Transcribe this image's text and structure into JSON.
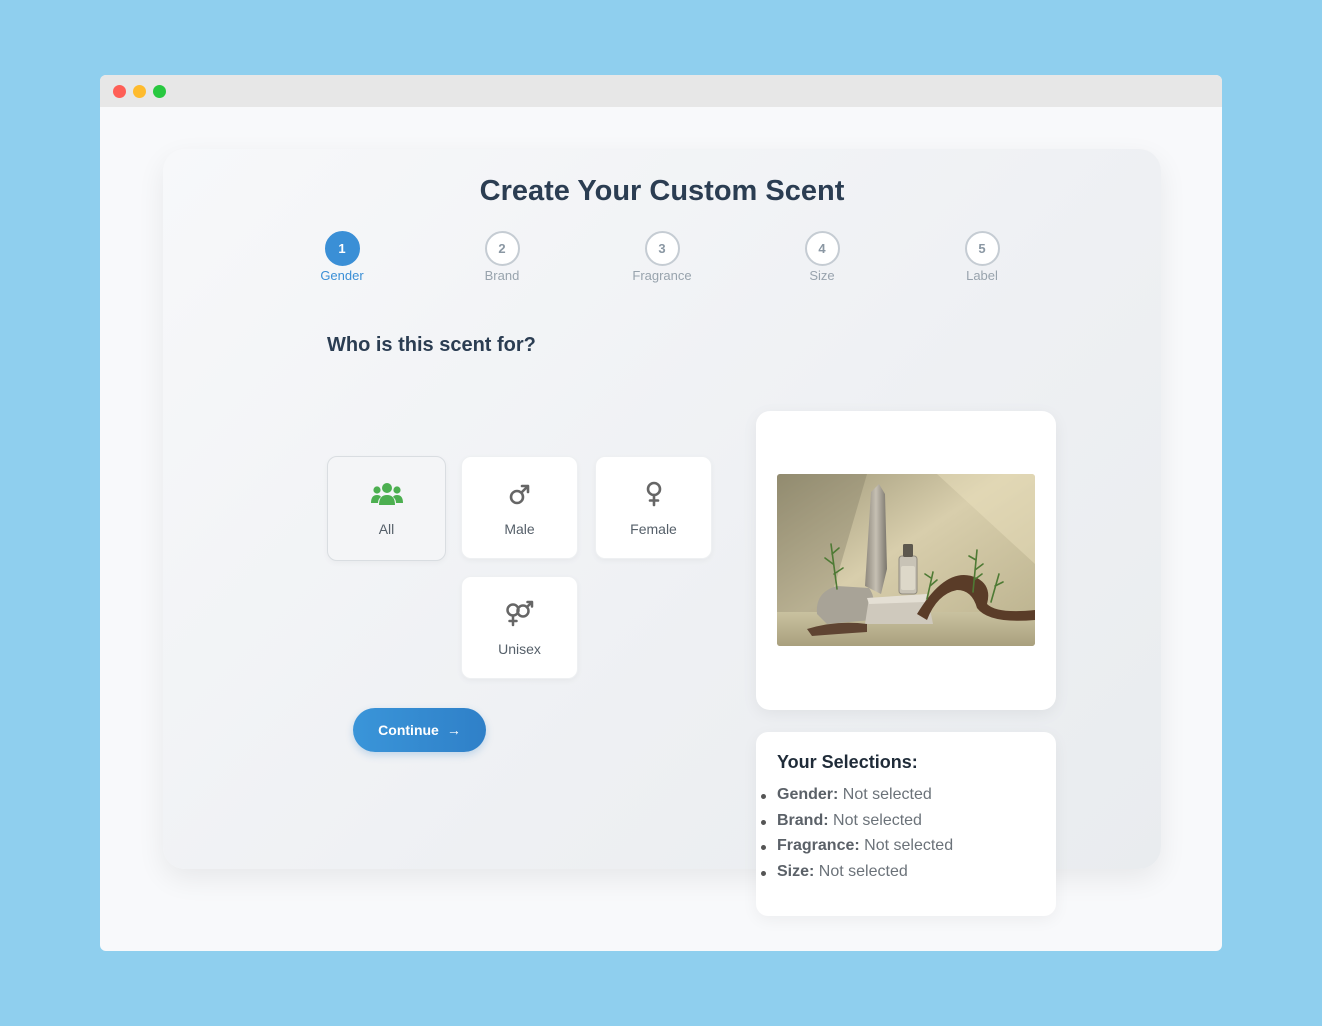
{
  "page": {
    "title": "Create Your Custom Scent"
  },
  "steps": [
    {
      "number": "1",
      "label": "Gender",
      "active": true
    },
    {
      "number": "2",
      "label": "Brand",
      "active": false
    },
    {
      "number": "3",
      "label": "Fragrance",
      "active": false
    },
    {
      "number": "4",
      "label": "Size",
      "active": false
    },
    {
      "number": "5",
      "label": "Label",
      "active": false
    }
  ],
  "question": "Who is this scent for?",
  "options": [
    {
      "label": "All",
      "icon": "users-icon",
      "selected": true,
      "color": "#4caf50"
    },
    {
      "label": "Male",
      "icon": "male-icon",
      "selected": false,
      "color": "#666666"
    },
    {
      "label": "Female",
      "icon": "female-icon",
      "selected": false,
      "color": "#666666"
    },
    {
      "label": "Unisex",
      "icon": "unisex-icon",
      "selected": false,
      "color": "#666666"
    }
  ],
  "continue_button": {
    "label": "Continue",
    "arrow": "→"
  },
  "preview": {
    "image": "perfume-bottle-on-stones"
  },
  "selections": {
    "heading": "Your Selections:",
    "items": [
      {
        "key": "Gender:",
        "value": "Not selected"
      },
      {
        "key": "Brand:",
        "value": "Not selected"
      },
      {
        "key": "Fragrance:",
        "value": "Not selected"
      },
      {
        "key": "Size:",
        "value": "Not selected"
      }
    ]
  },
  "colors": {
    "accent": "#3a8fd6",
    "heading": "#2b3d52",
    "background": "#8fcfee"
  }
}
